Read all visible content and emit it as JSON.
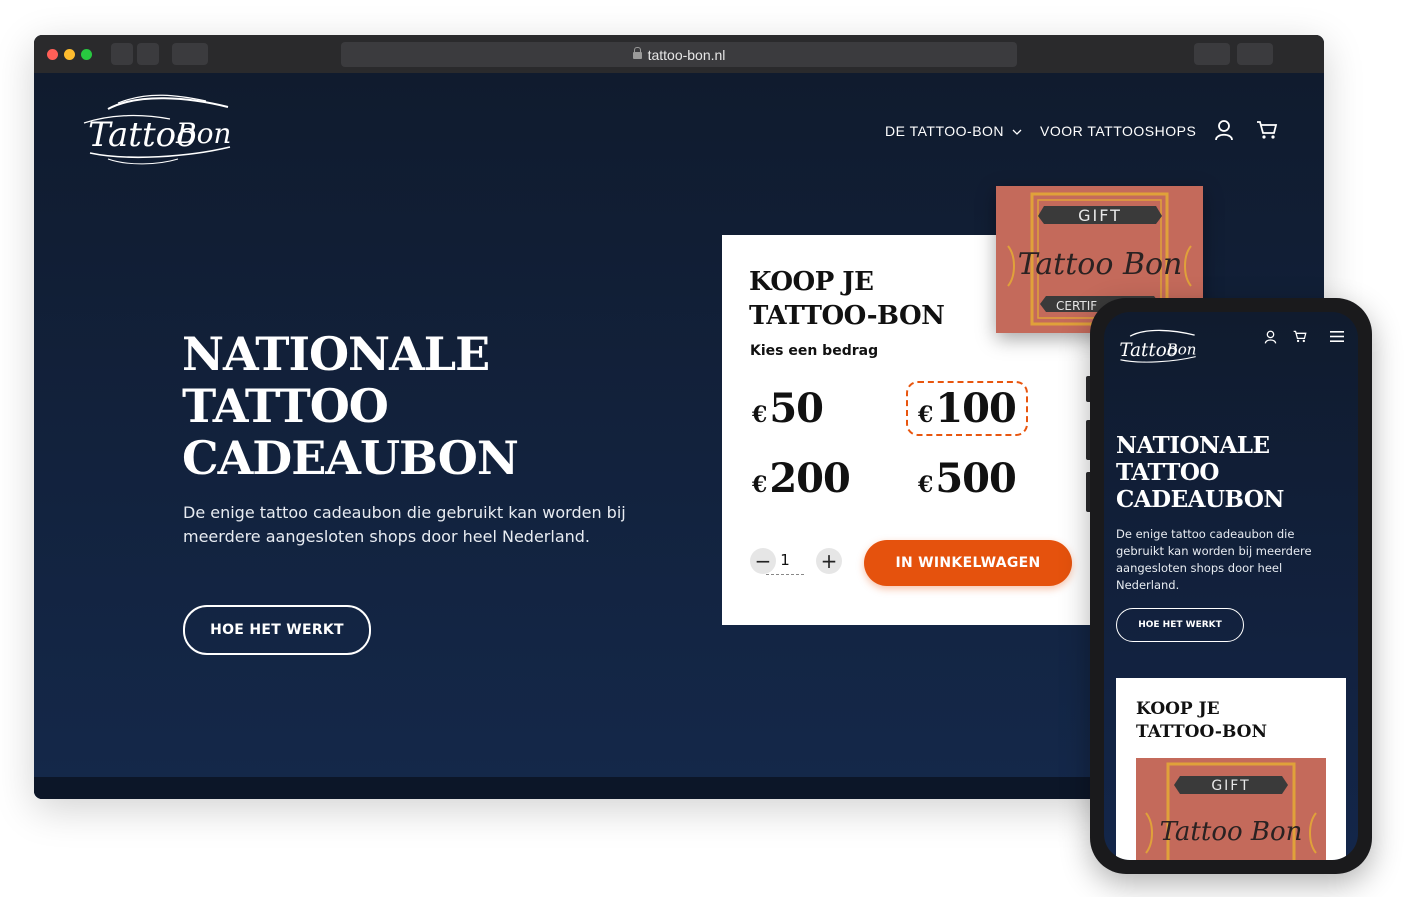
{
  "browser": {
    "url": "tattoo-bon.nl",
    "traffic_lights": [
      "#ff5f57",
      "#febc2e",
      "#28c840"
    ]
  },
  "site": {
    "logo_text": "Tattoo Bon",
    "nav": {
      "item1": "DE TATTOO-BON",
      "item2": "VOOR TATTOOSHOPS"
    },
    "hero": {
      "title_line1": "NATIONALE",
      "title_line2": "TATTOO",
      "title_line3": "CADEAUBON",
      "subtitle": "De enige tattoo cadeaubon die gebruikt kan worden bij meerdere aangesloten shops door heel Nederland.",
      "button": "HOE HET WERKT"
    },
    "card": {
      "title_line1": "KOOP JE",
      "title_line2": "TATTOO-BON",
      "subtitle": "Kies een bedrag",
      "currency": "€",
      "amounts": [
        "50",
        "100",
        "200",
        "500"
      ],
      "selected_amount": "100",
      "quantity": "1",
      "minus": "−",
      "plus": "+",
      "cart_button": "IN WINKELWAGEN"
    },
    "gift_card": {
      "top_text": "GIFT",
      "logo_text": "Tattoo Bon",
      "bottom_text": "CERTIF"
    }
  },
  "mobile": {
    "logo_text": "Tattoo Bon",
    "title_line1": "NATIONALE",
    "title_line2": "TATTOO",
    "title_line3": "CADEAUBON",
    "subtitle": "De enige tattoo cadeaubon die gebruikt kan worden bij meerdere aangesloten shops door heel Nederland.",
    "button": "HOE HET WERKT",
    "card_title_line1": "KOOP JE",
    "card_title_line2": "TATTOO-BON",
    "gift_top_text": "GIFT",
    "gift_logo_text": "Tattoo Bon"
  },
  "colors": {
    "accent": "#e5520d",
    "background": "#0f1d33",
    "gift_card": "#c76a5c"
  }
}
